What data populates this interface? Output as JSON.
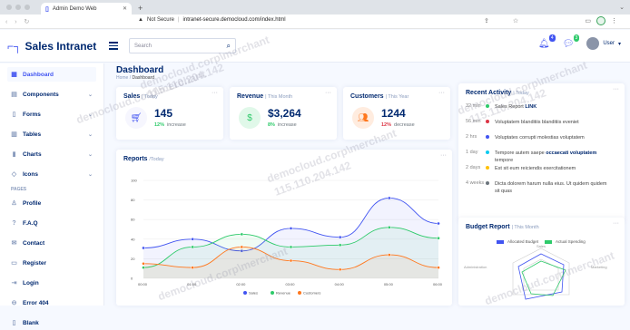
{
  "browser": {
    "tab_title": "Admin Demo Web",
    "url_warning": "Not Secure",
    "url": "intranet-secure.democloud.com/index.html"
  },
  "header": {
    "app_name": "Sales Intranet",
    "search_placeholder": "Search",
    "notif_count": "4",
    "msg_count": "3",
    "user_label": "User"
  },
  "sidebar": {
    "items": [
      {
        "label": "Dashboard",
        "icon": "grid-icon",
        "chevron": false
      },
      {
        "label": "Components",
        "icon": "menu-icon",
        "chevron": true
      },
      {
        "label": "Forms",
        "icon": "journal-icon",
        "chevron": true
      },
      {
        "label": "Tables",
        "icon": "layout-icon",
        "chevron": true
      },
      {
        "label": "Charts",
        "icon": "bar-chart-icon",
        "chevron": true
      },
      {
        "label": "Icons",
        "icon": "gem-icon",
        "chevron": true
      }
    ],
    "pages_heading": "PAGES",
    "pages": [
      {
        "label": "Profile",
        "icon": "person-icon"
      },
      {
        "label": "F.A.Q",
        "icon": "question-icon"
      },
      {
        "label": "Contact",
        "icon": "envelope-icon"
      },
      {
        "label": "Register",
        "icon": "card-icon"
      },
      {
        "label": "Login",
        "icon": "login-icon"
      },
      {
        "label": "Error 404",
        "icon": "dash-circle-icon"
      },
      {
        "label": "Blank",
        "icon": "file-icon"
      }
    ]
  },
  "page": {
    "title": "Dashboard",
    "crumb_home": "Home",
    "crumb_sep": "/",
    "crumb_current": "Dashboard"
  },
  "stats": [
    {
      "title": "Sales",
      "period": "| Today",
      "value": "145",
      "change": "12%",
      "change_text": "increase",
      "change_color": "#2eca6a",
      "icon": "cart-icon"
    },
    {
      "title": "Revenue",
      "period": "| This Month",
      "value": "$3,264",
      "change": "8%",
      "change_text": "increase",
      "change_color": "#2eca6a",
      "icon": "dollar-icon"
    },
    {
      "title": "Customers",
      "period": "| This Year",
      "value": "1244",
      "change": "12%",
      "change_text": "decrease",
      "change_color": "#dc3545",
      "icon": "people-icon"
    }
  ],
  "reports": {
    "title": "Reports",
    "period": "/Today"
  },
  "activity": {
    "title": "Recent Activity",
    "period": "| Today",
    "items": [
      {
        "time": "32 min",
        "color": "#2eca6a",
        "text": "Sales Report",
        "bold": "LINK",
        "after": ""
      },
      {
        "time": "56 min",
        "color": "#dc3545",
        "text": "Voluptatem blanditiis blanditiis eveniet",
        "bold": "",
        "after": ""
      },
      {
        "time": "2 hrs",
        "color": "#4154f1",
        "text": "Voluptates corrupti molestias voluptatem",
        "bold": "",
        "after": ""
      },
      {
        "time": "1 day",
        "color": "#0dcaf0",
        "text": "Tempore autem saepe",
        "bold": "occaecati voluptatem",
        "after": "tempore"
      },
      {
        "time": "2 days",
        "color": "#ffc107",
        "text": "Est sit eum reiciendis exercitationem",
        "bold": "",
        "after": ""
      },
      {
        "time": "4 weeks",
        "color": "#6c757d",
        "text": "Dicta dolorem harum nulla eius. Ut quidem quidem sit quas",
        "bold": "",
        "after": ""
      }
    ]
  },
  "budget": {
    "title": "Budget Report",
    "period": "| This Month",
    "legend": [
      "Allocated Budget",
      "Actual Spending"
    ],
    "axes": [
      "Sales",
      "Marketing",
      "Administration"
    ]
  },
  "watermark": [
    "democloud.corp\\merchant",
    "115.110.204.142"
  ],
  "chart_data": [
    {
      "type": "line",
      "title": "Reports",
      "x": [
        "00:00",
        "01:00",
        "02:00",
        "03:00",
        "04:00",
        "05:00",
        "06:00"
      ],
      "ylim": [
        0,
        100
      ],
      "yticks": [
        "0",
        "20",
        "40",
        "60",
        "80",
        "100"
      ],
      "series": [
        {
          "name": "Sales",
          "color": "#4154f1",
          "values": [
            31,
            40,
            28,
            51,
            42,
            82,
            56
          ]
        },
        {
          "name": "Revenue",
          "color": "#2eca6a",
          "values": [
            11,
            32,
            45,
            32,
            34,
            52,
            41
          ]
        },
        {
          "name": "Customers",
          "color": "#ff771d",
          "values": [
            15,
            11,
            32,
            18,
            9,
            24,
            11
          ]
        }
      ]
    }
  ],
  "colors": {
    "accent": "#4154f1",
    "text": "#012970",
    "muted": "#899bbd"
  }
}
